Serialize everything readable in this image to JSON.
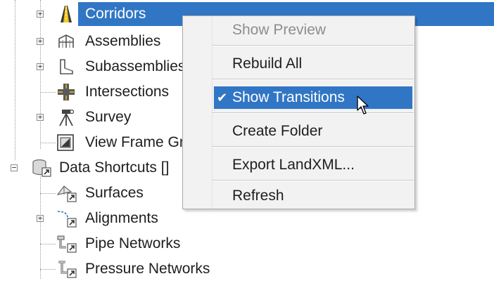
{
  "tree": {
    "items": [
      {
        "label": "Corridors",
        "icon": "corridor-icon",
        "expandable": true,
        "selected": true
      },
      {
        "label": "Assemblies",
        "icon": "assembly-icon",
        "expandable": true
      },
      {
        "label": "Subassemblies",
        "icon": "subassembly-icon",
        "expandable": true
      },
      {
        "label": "Intersections",
        "icon": "intersection-icon",
        "expandable": false
      },
      {
        "label": "Survey",
        "icon": "survey-icon",
        "expandable": true
      },
      {
        "label": "View Frame Gr",
        "icon": "view-frame-icon",
        "expandable": false
      },
      {
        "label": "Data Shortcuts []",
        "icon": "data-shortcuts-icon",
        "expandable": true,
        "expanded": true
      },
      {
        "label": "Surfaces",
        "icon": "surface-shortcut-icon",
        "expandable": false
      },
      {
        "label": "Alignments",
        "icon": "alignment-shortcut-icon",
        "expandable": true
      },
      {
        "label": "Pipe Networks",
        "icon": "pipe-network-shortcut-icon",
        "expandable": false
      },
      {
        "label": "Pressure Networks",
        "icon": "pressure-network-shortcut-icon",
        "expandable": false
      }
    ]
  },
  "context_menu": {
    "items": [
      {
        "label": "Show Preview",
        "disabled": true
      },
      {
        "label": "Rebuild All"
      },
      {
        "label": "Show Transitions",
        "checked": true,
        "highlighted": true
      },
      {
        "label": "Create Folder"
      },
      {
        "label": "Export LandXML..."
      },
      {
        "label": "Refresh"
      }
    ],
    "check_glyph": "✔"
  },
  "colors": {
    "selection": "#3176c5",
    "menu_background": "#f2f2f2",
    "disabled_text": "#8d8d8d"
  }
}
